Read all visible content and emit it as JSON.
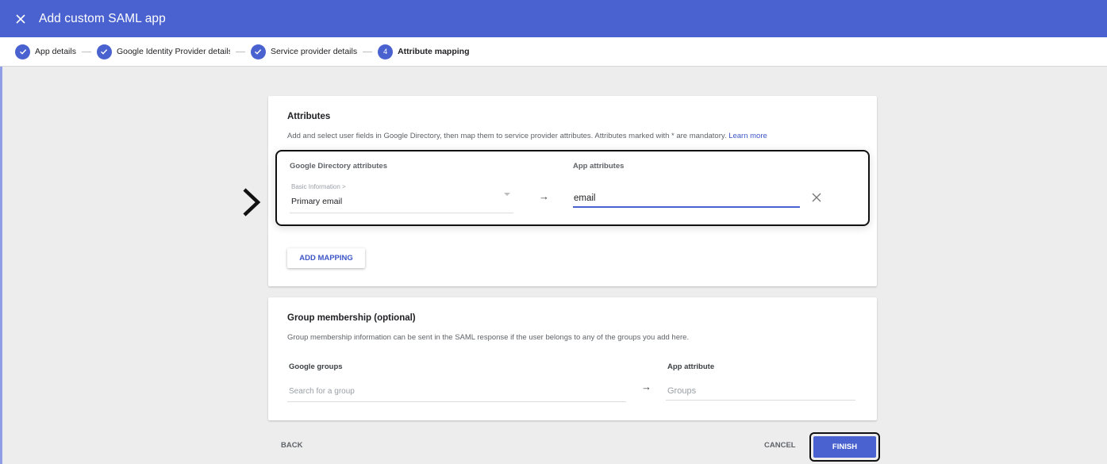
{
  "header": {
    "title": "Add custom SAML app",
    "close_icon": "close-icon"
  },
  "stepper": {
    "steps": [
      {
        "label": "App details",
        "state": "done",
        "icon": "check-icon"
      },
      {
        "label": "Google Identity Provider details",
        "state": "done",
        "icon": "check-icon"
      },
      {
        "label": "Service provider details",
        "state": "done",
        "icon": "check-icon"
      },
      {
        "label": "Attribute mapping",
        "state": "current",
        "number": "4"
      }
    ]
  },
  "attributes": {
    "title": "Attributes",
    "description": "Add and select user fields in Google Directory, then map them to service provider attributes. Attributes marked with * are mandatory.",
    "learn_more": "Learn more",
    "directory_header": "Google Directory attributes",
    "app_header": "App attributes",
    "mapping": {
      "category": "Basic Information >",
      "field": "Primary email",
      "arrow": "→",
      "app_value": "email"
    },
    "add_mapping_label": "ADD MAPPING"
  },
  "groups": {
    "title": "Group membership (optional)",
    "description": "Group membership information can be sent in the SAML response if the user belongs to any of the groups you add here.",
    "google_groups_header": "Google groups",
    "search_placeholder": "Search for a group",
    "arrow": "→",
    "app_attribute_header": "App attribute",
    "app_attribute_placeholder": "Groups"
  },
  "footer": {
    "back_label": "BACK",
    "cancel_label": "CANCEL",
    "finish_label": "FINISH"
  },
  "colors": {
    "primary": "#4a62cf",
    "link": "#3c55c7",
    "background": "#ededed"
  }
}
